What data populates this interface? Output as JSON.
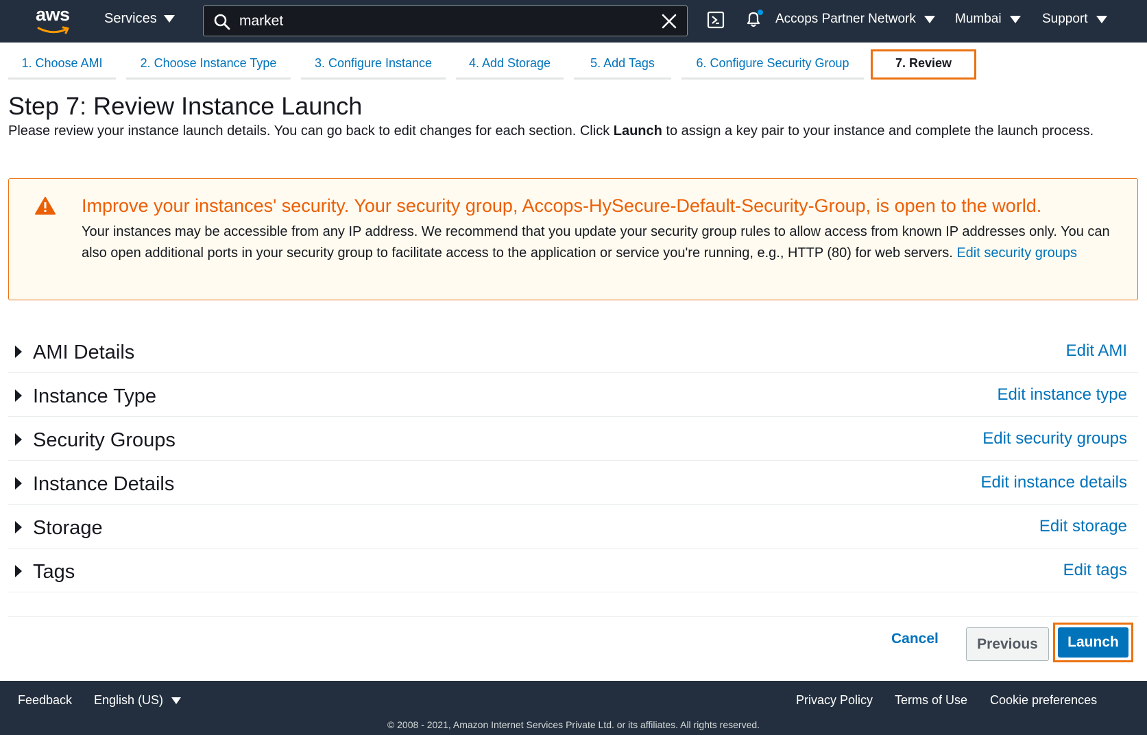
{
  "topnav": {
    "logo_text": "aws",
    "services_label": "Services",
    "search_value": "market",
    "account_label": "Accops Partner Network",
    "region_label": "Mumbai",
    "support_label": "Support"
  },
  "tabs": [
    {
      "label": "1. Choose AMI"
    },
    {
      "label": "2. Choose Instance Type"
    },
    {
      "label": "3. Configure Instance"
    },
    {
      "label": "4. Add Storage"
    },
    {
      "label": "5. Add Tags"
    },
    {
      "label": "6. Configure Security Group"
    },
    {
      "label": "7. Review",
      "active": true
    }
  ],
  "page": {
    "title": "Step 7: Review Instance Launch",
    "intro_before": "Please review your instance launch details. You can go back to edit changes for each section. Click ",
    "intro_bold": "Launch",
    "intro_after": " to assign a key pair to your instance and complete the launch process."
  },
  "alert": {
    "title": "Improve your instances' security. Your security group, Accops-HySecure-Default-Security-Group, is open to the world.",
    "body": "Your instances may be accessible from any IP address. We recommend that you update your security group rules to allow access from known IP addresses only. You can also open additional ports in your security group to facilitate access to the application or service you're running, e.g., HTTP (80) for web servers. ",
    "link": "Edit security groups"
  },
  "sections": [
    {
      "title": "AMI Details",
      "edit": "Edit AMI"
    },
    {
      "title": "Instance Type",
      "edit": "Edit instance type"
    },
    {
      "title": "Security Groups",
      "edit": "Edit security groups"
    },
    {
      "title": "Instance Details",
      "edit": "Edit instance details"
    },
    {
      "title": "Storage",
      "edit": "Edit storage"
    },
    {
      "title": "Tags",
      "edit": "Edit tags"
    }
  ],
  "actions": {
    "cancel": "Cancel",
    "previous": "Previous",
    "launch": "Launch"
  },
  "footer": {
    "feedback": "Feedback",
    "language": "English (US)",
    "privacy": "Privacy Policy",
    "terms": "Terms of Use",
    "cookies": "Cookie preferences",
    "copyright": "© 2008 - 2021, Amazon Internet Services Private Ltd. or its affiliates. All rights reserved."
  },
  "colors": {
    "nav_bg": "#232f3e",
    "link": "#0073bb",
    "warning_orange": "#ec7211",
    "primary_button": "#0073bb"
  }
}
